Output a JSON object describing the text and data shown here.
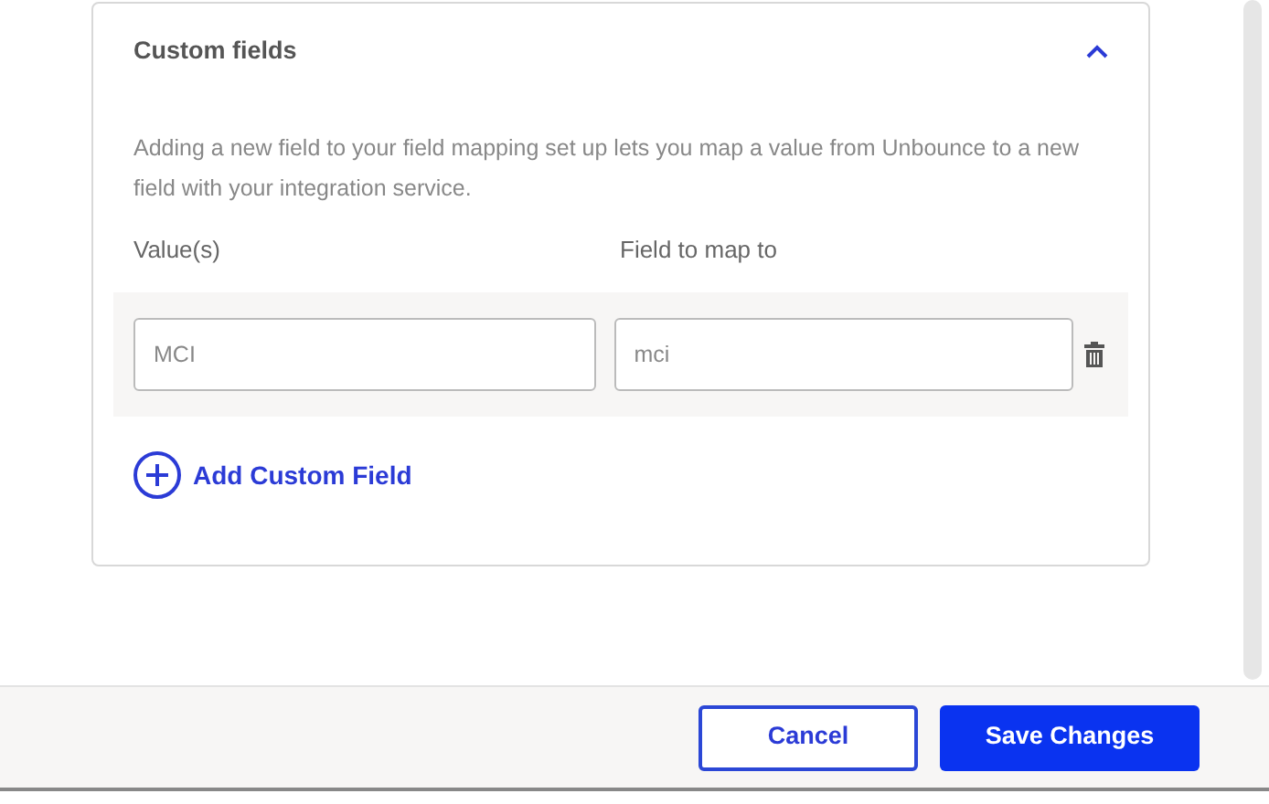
{
  "panel": {
    "title": "Custom fields",
    "expanded": true,
    "description": "Adding a new field to your field mapping set up lets you map a value from Unbounce to a new field with your integration service.",
    "columns": [
      "Value(s)",
      "Field to map to"
    ],
    "rows": [
      {
        "value": "MCI",
        "field": "mci"
      }
    ],
    "add_button": "Add Custom Field"
  },
  "buttons": [
    {
      "label": "Cancel",
      "kind": "secondary"
    },
    {
      "label": "Save Changes",
      "kind": "primary"
    }
  ]
}
